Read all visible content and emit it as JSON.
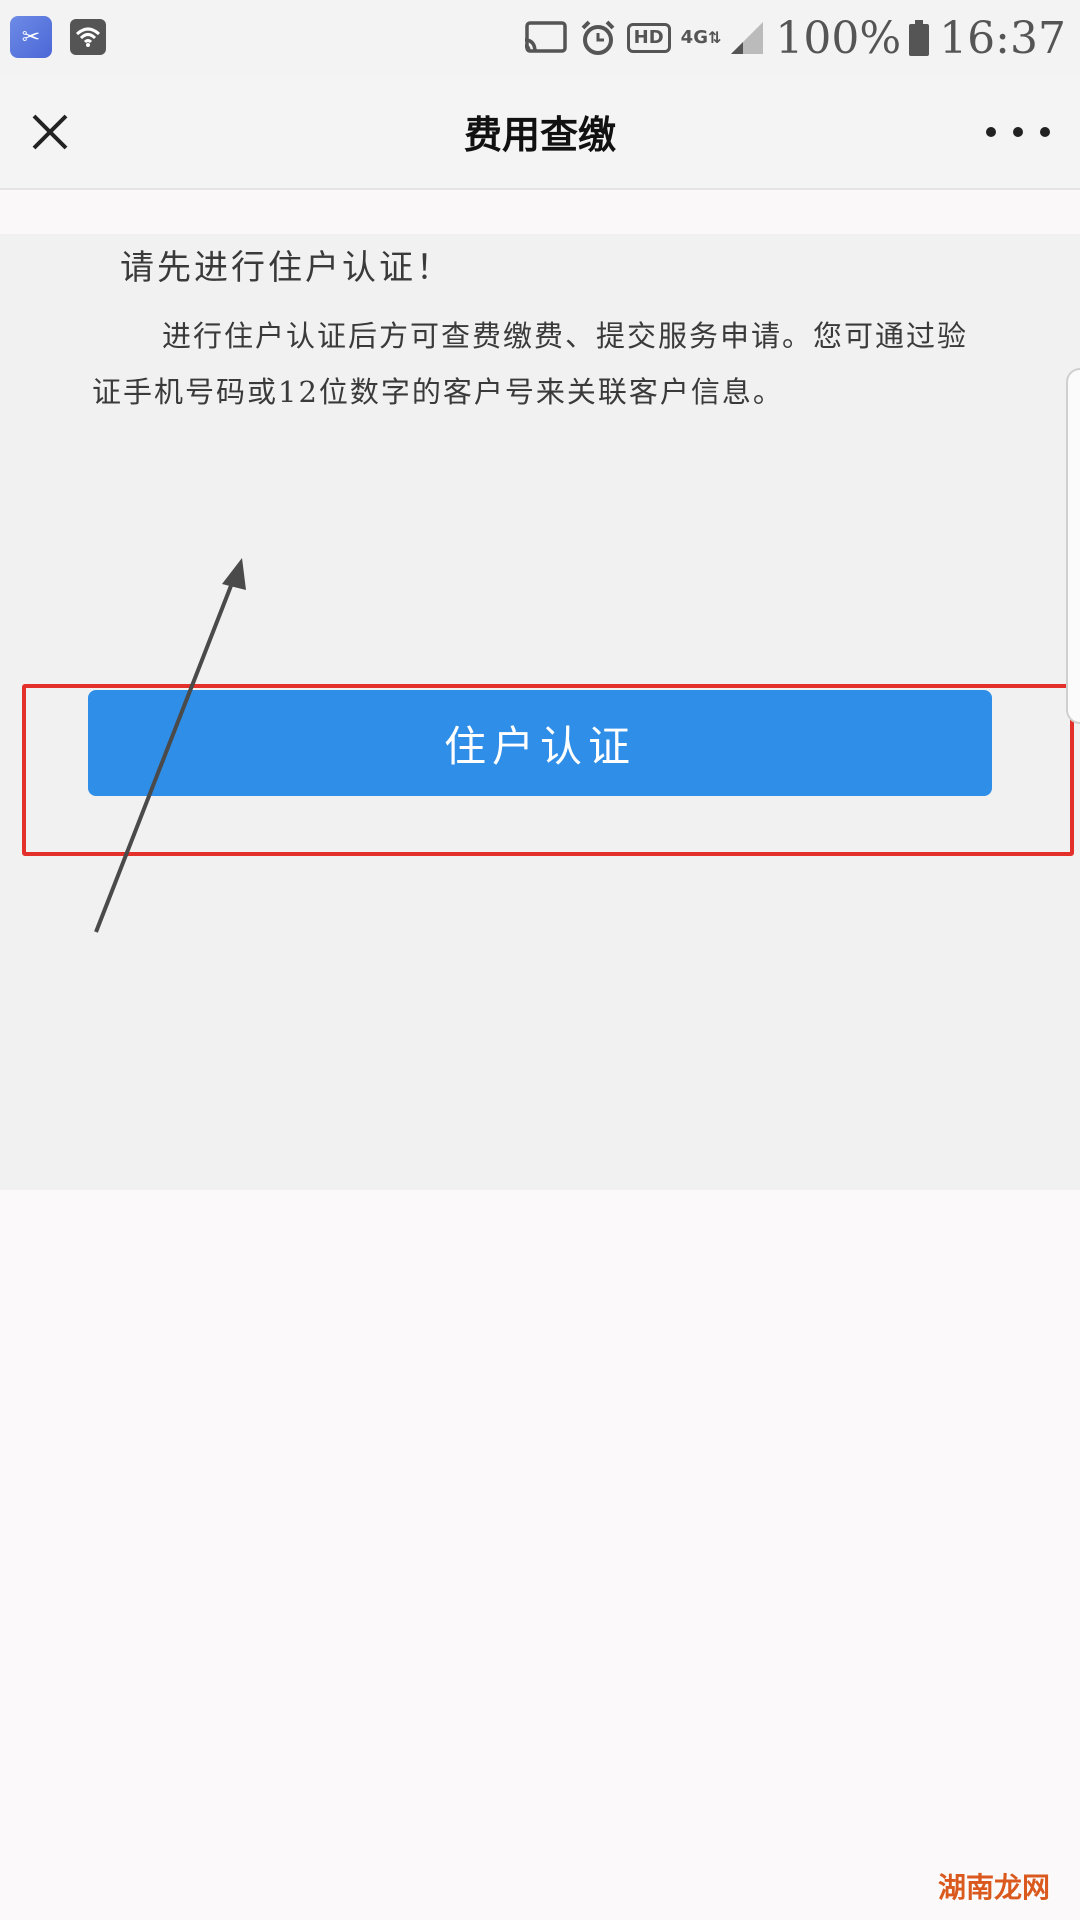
{
  "status_bar": {
    "battery_percent": "100%",
    "time": "16:37",
    "hd_label": "HD",
    "network_label": "4G",
    "icons": [
      "app-icon",
      "wifi-icon",
      "cast-icon",
      "alarm-icon",
      "hd-icon",
      "4g-icon",
      "signal-icon",
      "battery-icon"
    ]
  },
  "title_bar": {
    "title": "费用查缴",
    "left_icon": "close-icon",
    "right_icon": "more-icon"
  },
  "notice": {
    "title": "请先进行住户认证！",
    "body": "进行住户认证后方可查费缴费、提交服务申请。您可通过验证手机号码或12位数字的客户号来关联客户信息。"
  },
  "actions": {
    "verify_button_label": "住户认证"
  },
  "annotations": {
    "highlight_color": "#e3302b",
    "arrow_color": "#4a4a4a"
  },
  "colors": {
    "accent": "#2f8ee8",
    "page_background": "#f1f1f1"
  },
  "watermark": {
    "text": "湖南龙网"
  }
}
